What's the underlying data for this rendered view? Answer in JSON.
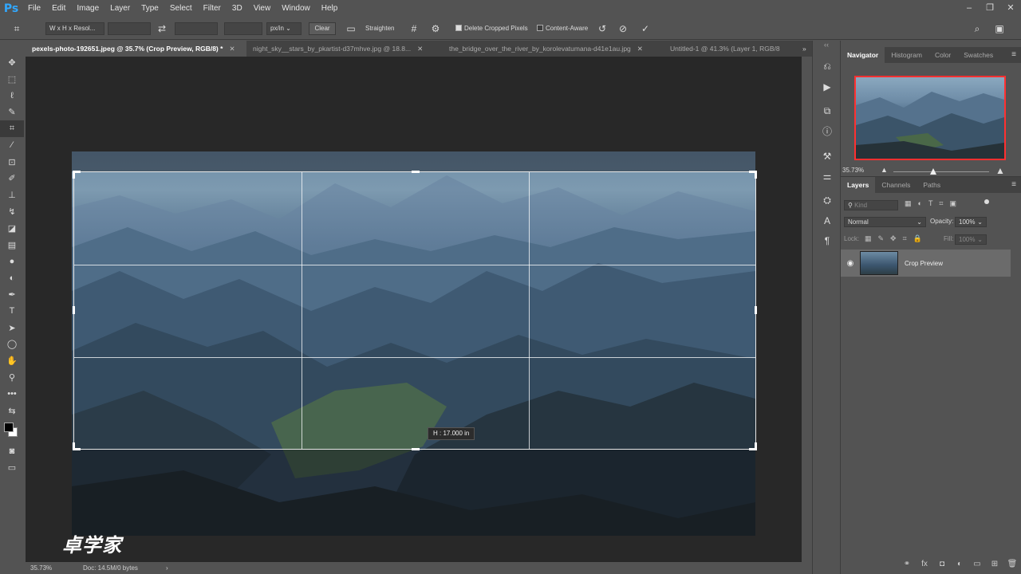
{
  "app": {
    "logo": "Ps"
  },
  "menu": [
    "File",
    "Edit",
    "Image",
    "Layer",
    "Type",
    "Select",
    "Filter",
    "3D",
    "View",
    "Window",
    "Help"
  ],
  "options": {
    "ratio_preset": "W x H x Resol...",
    "unit": "px/in",
    "clear_label": "Clear",
    "straighten_label": "Straighten",
    "delete_cropped_label": "Delete Cropped Pixels",
    "delete_cropped_checked": true,
    "content_aware_label": "Content-Aware",
    "content_aware_checked": false
  },
  "tabs": [
    {
      "label": "pexels-photo-192651.jpeg @ 35.7% (Crop Preview, RGB/8) *",
      "active": true
    },
    {
      "label": "night_sky__stars_by_pkartist-d37mhve.jpg @ 18.8...",
      "active": false
    },
    {
      "label": "the_bridge_over_the_river_by_korolevatumana-d41e1au.jpg",
      "active": false
    },
    {
      "label": "Untitled-1 @ 41.3% (Layer 1, RGB/8",
      "active": false
    }
  ],
  "canvas": {
    "height_readout": "H :  17.000 in",
    "watermark": "卓学家"
  },
  "status": {
    "zoom": "35.73%",
    "doc": "Doc: 14.5M/0 bytes"
  },
  "navigator": {
    "tabs": [
      "Navigator",
      "Histogram",
      "Color",
      "Swatches"
    ],
    "zoom": "35.73%"
  },
  "layers": {
    "tabs": [
      "Layers",
      "Channels",
      "Paths"
    ],
    "kind_placeholder": "Kind",
    "blend_mode": "Normal",
    "opacity_label": "Opacity:",
    "opacity_value": "100%",
    "lock_label": "Lock:",
    "fill_label": "Fill:",
    "fill_value": "100%",
    "items": [
      {
        "name": "Crop Preview",
        "visible": true
      }
    ]
  }
}
